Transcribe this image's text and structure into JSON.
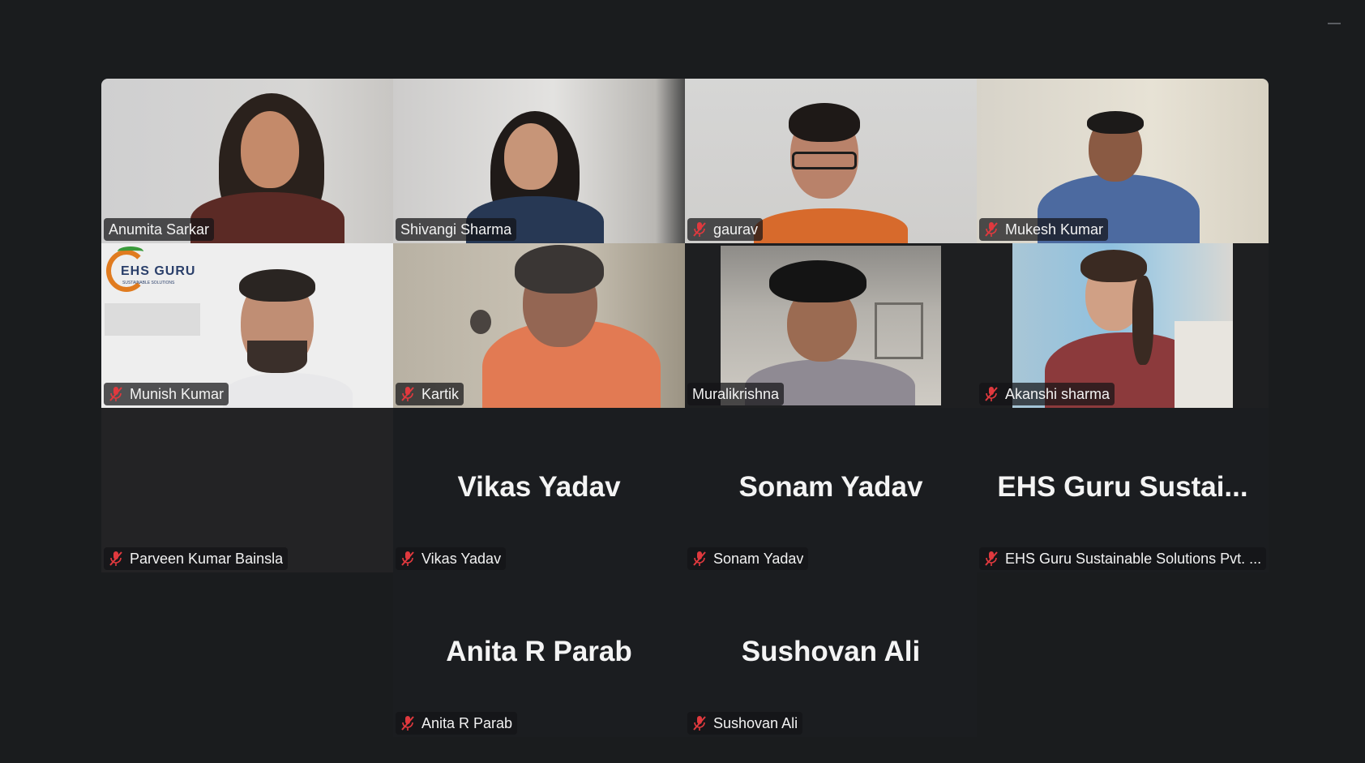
{
  "window": {
    "minimize_icon": "minimize-icon"
  },
  "participants": [
    {
      "name": "Anumita Sarkar",
      "muted": false,
      "video": true
    },
    {
      "name": "Shivangi Sharma",
      "muted": false,
      "video": true
    },
    {
      "name": "gaurav",
      "muted": true,
      "video": true
    },
    {
      "name": "Mukesh Kumar",
      "muted": true,
      "video": true
    },
    {
      "name": "Munish Kumar",
      "muted": true,
      "video": true,
      "background_logo": "EHS GURU",
      "background_logo_sub": "SUSTAINABLE SOLUTIONS"
    },
    {
      "name": "Kartik",
      "muted": true,
      "video": true
    },
    {
      "name": "Muralikrishna",
      "muted": false,
      "video": true,
      "active_speaker": true
    },
    {
      "name": "Akanshi sharma",
      "muted": true,
      "video": true
    },
    {
      "name": "Parveen Kumar Bainsla",
      "muted": true,
      "video": false,
      "display_name": ""
    },
    {
      "name": "Vikas Yadav",
      "muted": true,
      "video": false,
      "display_name": "Vikas Yadav"
    },
    {
      "name": "Sonam Yadav",
      "muted": true,
      "video": false,
      "display_name": "Sonam Yadav"
    },
    {
      "name": "EHS Guru Sustainable Solutions Pvt. ...",
      "muted": true,
      "video": false,
      "display_name": "EHS Guru Sustai..."
    },
    {
      "name": "Anita R Parab",
      "muted": true,
      "video": false,
      "display_name": "Anita R Parab"
    },
    {
      "name": "Sushovan Ali",
      "muted": true,
      "video": false,
      "display_name": "Sushovan Ali"
    }
  ],
  "colors": {
    "active_speaker_border": "#2bd07a",
    "muted_icon": "#e0393e",
    "background": "#1a1c1e"
  }
}
